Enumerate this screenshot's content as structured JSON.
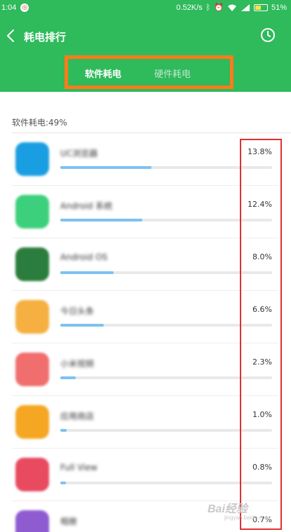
{
  "status_bar": {
    "time": "1:04",
    "network_speed": "0.52K/s",
    "battery_percent": "51%",
    "battery_level": 0.51,
    "icons": [
      "notification-icon",
      "bluetooth-icon",
      "alarm-off-icon",
      "wifi-icon",
      "signal-icon",
      "battery-icon"
    ]
  },
  "header": {
    "title": "耗电排行",
    "back_icon": "chevron-left-icon",
    "history_icon": "clock-icon",
    "background_color": "#2fba5b"
  },
  "tabs": [
    {
      "label": "软件耗电",
      "active": true
    },
    {
      "label": "硬件耗电",
      "active": false
    }
  ],
  "section": {
    "label": "软件耗电:49%"
  },
  "apps": [
    {
      "name": "UC浏览器",
      "percent": "13.8%",
      "share": 0.138,
      "icon": "app-icon-1",
      "icon_color": "#1a9ee2"
    },
    {
      "name": "Android 系统",
      "percent": "12.4%",
      "share": 0.124,
      "icon": "app-icon-2",
      "icon_color": "#3ccf7c"
    },
    {
      "name": "Android OS",
      "percent": "8.0%",
      "share": 0.08,
      "icon": "app-icon-3",
      "icon_color": "#2a7d3c"
    },
    {
      "name": "今日头条",
      "percent": "6.6%",
      "share": 0.066,
      "icon": "app-icon-4",
      "icon_color": "#f5b041"
    },
    {
      "name": "小米视频",
      "percent": "2.3%",
      "share": 0.023,
      "icon": "app-icon-5",
      "icon_color": "#f06e6e"
    },
    {
      "name": "应用商店",
      "percent": "1.0%",
      "share": 0.01,
      "icon": "app-icon-6",
      "icon_color": "#f5a623"
    },
    {
      "name": "Full View",
      "percent": "0.8%",
      "share": 0.008,
      "icon": "app-icon-7",
      "icon_color": "#e84a5f"
    },
    {
      "name": "相册",
      "percent": "0.7%",
      "share": 0.007,
      "icon": "app-icon-8",
      "icon_color": "#8e5bd1"
    }
  ],
  "annotations": {
    "orange_frame_color": "#ff7a1a",
    "red_frame_color": "#e02f2f"
  },
  "watermark": {
    "logo": "Bai经验",
    "url": "jingyan.baidu.com"
  }
}
